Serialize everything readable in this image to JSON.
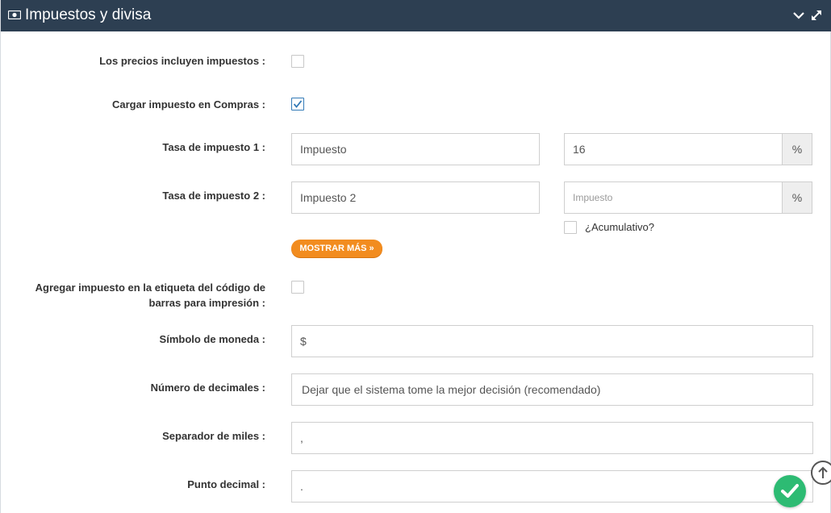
{
  "header": {
    "title": "Impuestos y divisa",
    "icon": "money-icon",
    "collapse_icon": "chevron-down-icon",
    "expand_icon": "expand-icon",
    "background": "#2d3f52"
  },
  "fields": {
    "prices_include_tax": {
      "label": "Los precios incluyen impuestos :",
      "checked": false
    },
    "charge_tax_purchases": {
      "label": "Cargar impuesto en Compras :",
      "checked": true
    },
    "tax_rate_1": {
      "label": "Tasa de impuesto 1 :",
      "name_value": "Impuesto",
      "rate_value": "16",
      "unit": "%"
    },
    "tax_rate_2": {
      "label": "Tasa de impuesto 2 :",
      "name_value": "Impuesto 2",
      "rate_value": "",
      "rate_placeholder": "Impuesto",
      "unit": "%",
      "cumulative_label": "¿Acumulativo?",
      "cumulative_checked": false
    },
    "show_more_label": "MOSTRAR MÁS »",
    "barcode_tax": {
      "label_line1": "Agregar impuesto en la etiqueta del código de",
      "label_line2": "barras para impresión :",
      "checked": false
    },
    "currency_symbol": {
      "label": "Símbolo de moneda :",
      "value": "$"
    },
    "decimals": {
      "label": "Número de decimales :",
      "value": "Dejar que el sistema tome la mejor decisión (recomendado)"
    },
    "thousands_separator": {
      "label": "Separador de miles :",
      "value": ","
    },
    "decimal_point": {
      "label": "Punto decimal :",
      "value": "."
    }
  },
  "colors": {
    "accent_orange": "#f28c1f",
    "save_green": "#2dbb73",
    "check_blue": "#337ab7"
  },
  "floating": {
    "scroll_top_icon": "arrow-up-circle-icon",
    "save_icon": "check-icon"
  }
}
